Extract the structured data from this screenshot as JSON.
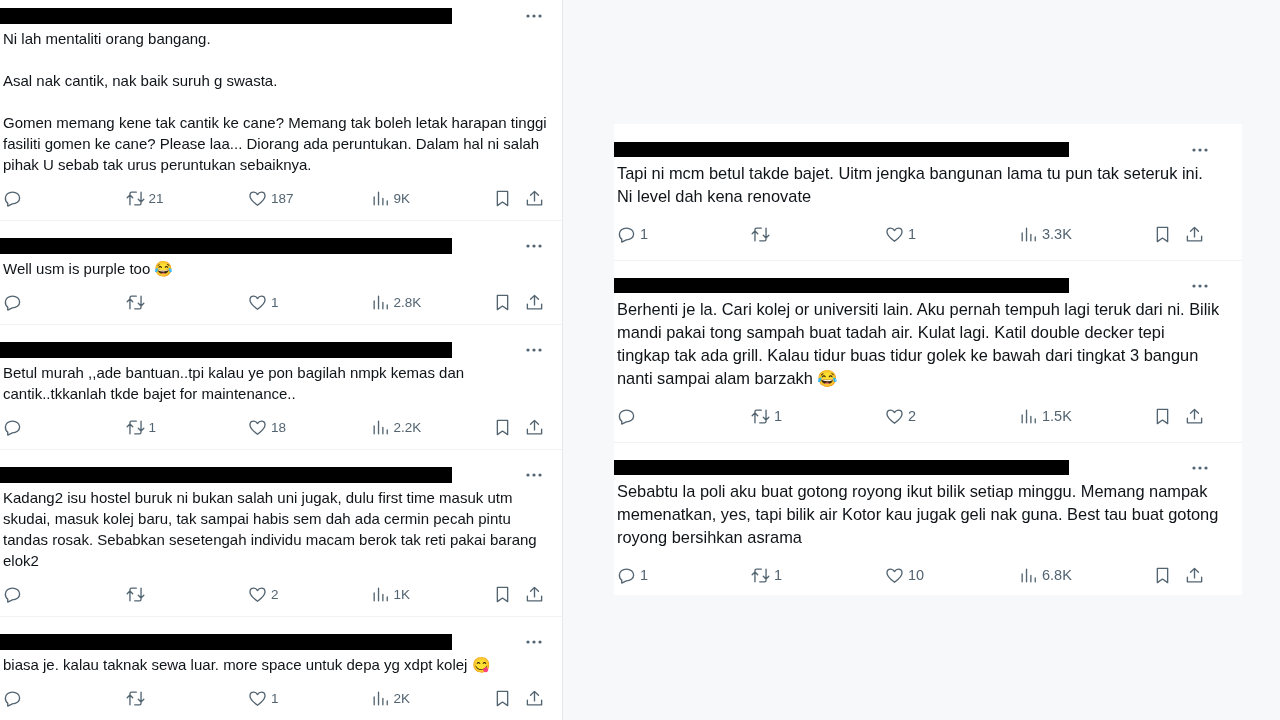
{
  "panels": [
    {
      "tweets": [
        {
          "author": {
            "redacted": true
          },
          "text": "Ni lah mentaliti orang bangang.\n\nAsal nak cantik, nak baik suruh g swasta.\n\nGomen memang kene tak cantik ke cane? Memang tak boleh letak harapan tinggi fasiliti gomen ke cane? Please laa... Diorang ada peruntukan. Dalam hal ni salah pihak U sebab tak urus peruntukan sebaiknya.",
          "retweets": "21",
          "likes": "187",
          "views": "9K"
        },
        {
          "author": {
            "redacted": true
          },
          "text": "Well usm is purple too 😂",
          "likes": "1",
          "views": "2.8K"
        },
        {
          "author": {
            "redacted": true
          },
          "text": "Betul murah ,,ade bantuan..tpi kalau ye pon bagilah nmpk kemas dan cantik..tkkanlah tkde bajet for maintenance..",
          "retweets": "1",
          "likes": "18",
          "views": "2.2K"
        },
        {
          "author": {
            "redacted": true
          },
          "text": "Kadang2 isu hostel buruk ni bukan salah uni jugak, dulu first time masuk utm skudai, masuk kolej baru, tak sampai habis sem dah ada cermin pecah pintu tandas rosak. Sebabkan sesetengah individu macam berok tak reti pakai barang elok2",
          "likes": "2",
          "views": "1K"
        },
        {
          "author": {
            "redacted": true
          },
          "text": "biasa je. kalau taknak sewa luar. more space untuk depa yg xdpt kolej 😋",
          "likes": "1",
          "views": "2K"
        }
      ]
    },
    {
      "tweets": [
        {
          "author": {
            "redacted": true
          },
          "text": "Tapi ni mcm betul takde bajet. Uitm jengka bangunan lama tu pun tak seteruk ini. Ni level dah kena renovate",
          "replies": "1",
          "likes": "1",
          "views": "3.3K"
        },
        {
          "author": {
            "redacted": true
          },
          "text": "Berhenti je la. Cari kolej or universiti lain. Aku pernah tempuh lagi teruk dari ni. Bilik mandi pakai tong sampah buat tadah air. Kulat lagi. Katil double decker tepi tingkap tak ada grill. Kalau tidur buas tidur golek ke bawah dari tingkat 3 bangun nanti sampai alam barzakh 😂",
          "retweets": "1",
          "likes": "2",
          "views": "1.5K"
        },
        {
          "author": {
            "redacted": true
          },
          "text": "Sebabtu la poli aku buat gotong royong ikut bilik setiap minggu. Memang nampak memenatkan, yes, tapi bilik air Kotor kau jugak geli nak guna. Best tau buat gotong royong bersihkan asrama",
          "replies": "1",
          "retweets": "1",
          "likes": "10",
          "views": "6.8K"
        }
      ]
    }
  ]
}
